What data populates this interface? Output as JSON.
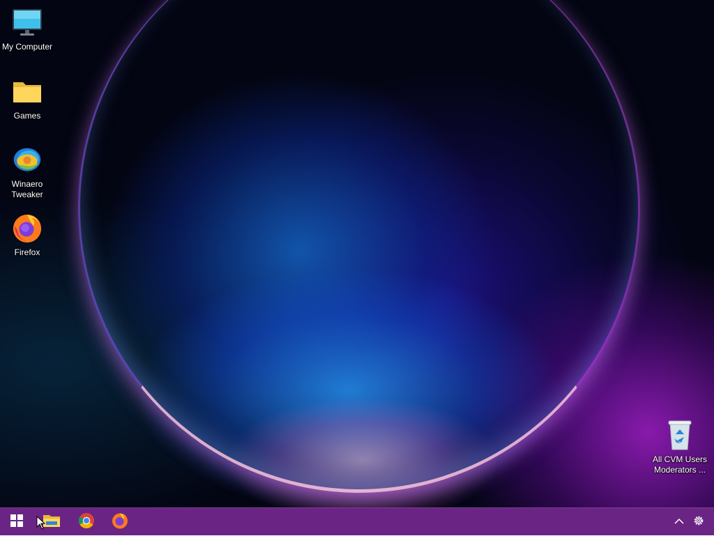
{
  "desktop": {
    "icons": [
      {
        "label": "My Computer",
        "icon": "monitor-icon"
      },
      {
        "label": "Games",
        "icon": "folder-icon"
      },
      {
        "label": "Winaero Tweaker",
        "icon": "winaero-tweaker-icon"
      },
      {
        "label": "Firefox",
        "icon": "firefox-icon"
      },
      {
        "label": "All CVM Users Moderators ...",
        "icon": "recycle-bin-icon"
      }
    ]
  },
  "taskbar": {
    "color": "#6a2584",
    "buttons": [
      {
        "name": "Start",
        "icon": "windows-logo-icon"
      },
      {
        "name": "File Explorer",
        "icon": "file-explorer-icon"
      },
      {
        "name": "Google Chrome",
        "icon": "chrome-icon"
      },
      {
        "name": "Firefox",
        "icon": "firefox-icon"
      }
    ],
    "tray": [
      {
        "name": "Show hidden icons",
        "icon": "chevron-up-icon"
      },
      {
        "name": "Settings",
        "icon": "gear-icon"
      }
    ]
  }
}
